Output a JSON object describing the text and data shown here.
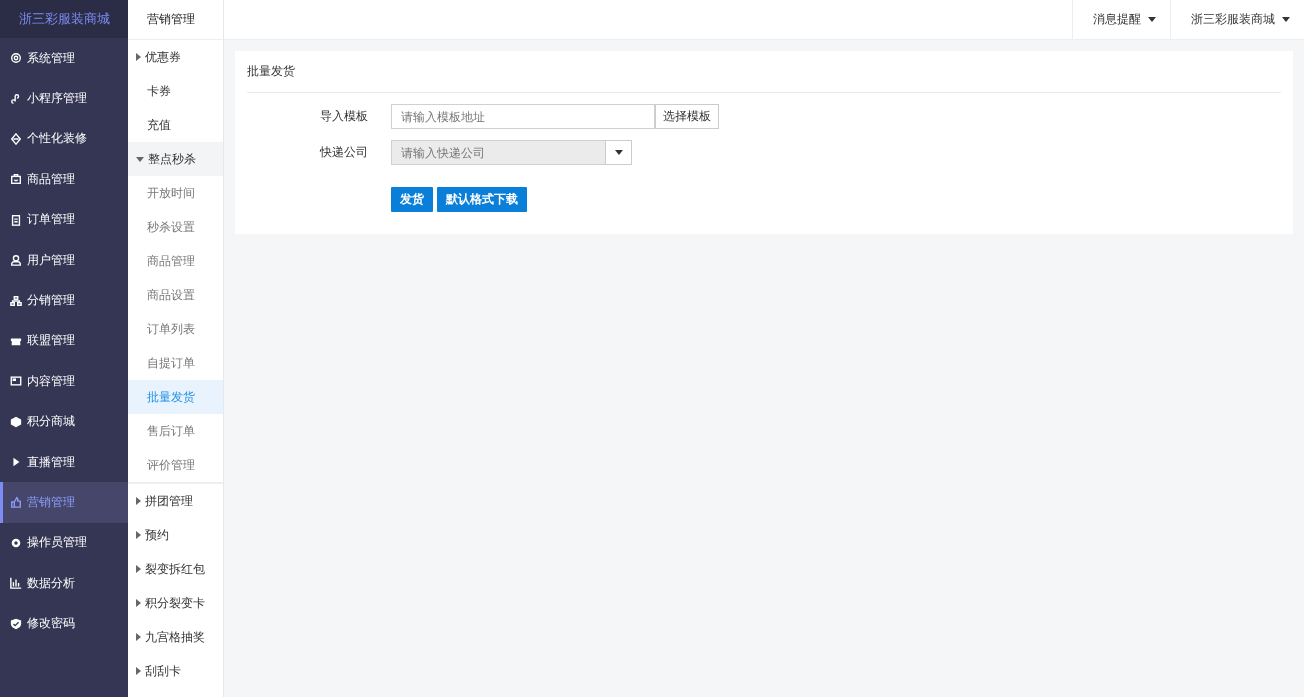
{
  "brand": {
    "title": "浙三彩服装商城"
  },
  "sidebar": {
    "items": [
      {
        "label": "系统管理",
        "selected": false
      },
      {
        "label": "小程序管理",
        "selected": false
      },
      {
        "label": "个性化装修",
        "selected": false
      },
      {
        "label": "商品管理",
        "selected": false
      },
      {
        "label": "订单管理",
        "selected": false
      },
      {
        "label": "用户管理",
        "selected": false
      },
      {
        "label": "分销管理",
        "selected": false
      },
      {
        "label": "联盟管理",
        "selected": false
      },
      {
        "label": "内容管理",
        "selected": false
      },
      {
        "label": "积分商城",
        "selected": false
      },
      {
        "label": "直播管理",
        "selected": false
      },
      {
        "label": "营销管理",
        "selected": true
      },
      {
        "label": "操作员管理",
        "selected": false
      },
      {
        "label": "数据分析",
        "selected": false
      },
      {
        "label": "修改密码",
        "selected": false
      }
    ]
  },
  "submenu": {
    "title": "营销管理",
    "items": [
      {
        "label": "优惠券",
        "kind": "group",
        "expanded": false
      },
      {
        "label": "卡券",
        "kind": "leaf",
        "selected": false
      },
      {
        "label": "充值",
        "kind": "leaf",
        "selected": false
      },
      {
        "label": "整点秒杀",
        "kind": "group",
        "expanded": true,
        "children": [
          {
            "label": "开放时间",
            "selected": false
          },
          {
            "label": "秒杀设置",
            "selected": false
          },
          {
            "label": "商品管理",
            "selected": false
          },
          {
            "label": "商品设置",
            "selected": false
          },
          {
            "label": "订单列表",
            "selected": false
          },
          {
            "label": "自提订单",
            "selected": false
          },
          {
            "label": "批量发货",
            "selected": true
          },
          {
            "label": "售后订单",
            "selected": false
          },
          {
            "label": "评价管理",
            "selected": false
          }
        ]
      },
      {
        "label": "拼团管理",
        "kind": "group",
        "expanded": false
      },
      {
        "label": "预约",
        "kind": "group",
        "expanded": false
      },
      {
        "label": "裂变拆红包",
        "kind": "group",
        "expanded": false
      },
      {
        "label": "积分裂变卡",
        "kind": "group",
        "expanded": false
      },
      {
        "label": "九宫格抽奖",
        "kind": "group",
        "expanded": false
      },
      {
        "label": "刮刮卡",
        "kind": "group",
        "expanded": false
      }
    ]
  },
  "topbar": {
    "menus": [
      "消息提醒",
      "浙三彩服装商城"
    ]
  },
  "panel": {
    "title": "批量发货",
    "fields": [
      {
        "label": "导入模板",
        "kind": "input",
        "placeholder": "请输入模板地址",
        "button": "选择模板",
        "disabled": false
      },
      {
        "label": "快递公司",
        "kind": "select",
        "placeholder": "请输入快递公司",
        "disabled": true
      }
    ],
    "buttons": [
      "发货",
      "默认格式下载"
    ]
  }
}
